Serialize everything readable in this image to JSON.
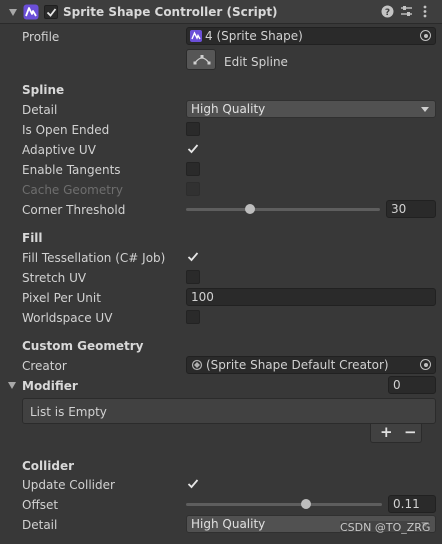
{
  "component": {
    "title": "Sprite Shape Controller (Script)",
    "enabled": true,
    "script_icon": "sprite-shape-icon",
    "header_icons": [
      "help-icon",
      "preset-icon",
      "more-menu-icon"
    ]
  },
  "profile": {
    "label": "Profile",
    "value": "4 (Sprite Shape)",
    "edit_button": "Edit Spline"
  },
  "spline": {
    "heading": "Spline",
    "detail_label": "Detail",
    "detail_value": "High Quality",
    "open_ended_label": "Is Open Ended",
    "open_ended": false,
    "adaptive_uv_label": "Adaptive UV",
    "adaptive_uv": true,
    "enable_tangents_label": "Enable Tangents",
    "enable_tangents": false,
    "cache_geometry_label": "Cache Geometry",
    "cache_geometry": false,
    "corner_threshold_label": "Corner Threshold",
    "corner_threshold_value": "30",
    "corner_threshold_fraction": 0.33
  },
  "fill": {
    "heading": "Fill",
    "tessellation_label": "Fill Tessellation (C# Job)",
    "tessellation": true,
    "stretch_uv_label": "Stretch UV",
    "stretch_uv": false,
    "pixel_per_unit_label": "Pixel Per Unit",
    "pixel_per_unit_value": "100",
    "worldspace_uv_label": "Worldspace UV",
    "worldspace_uv": false
  },
  "custom_geometry": {
    "heading": "Custom Geometry",
    "creator_label": "Creator",
    "creator_value": "(Sprite Shape Default Creator)"
  },
  "modifier": {
    "heading": "Modifier",
    "count": "0",
    "empty_text": "List is Empty",
    "add_label": "+",
    "remove_label": "−"
  },
  "collider": {
    "heading": "Collider",
    "update_collider_label": "Update Collider",
    "update_collider": true,
    "offset_label": "Offset",
    "offset_value": "0.11",
    "offset_fraction": 0.61,
    "detail_label": "Detail",
    "detail_value": "High Quality"
  },
  "watermark": "CSDN @TO_ZRG"
}
